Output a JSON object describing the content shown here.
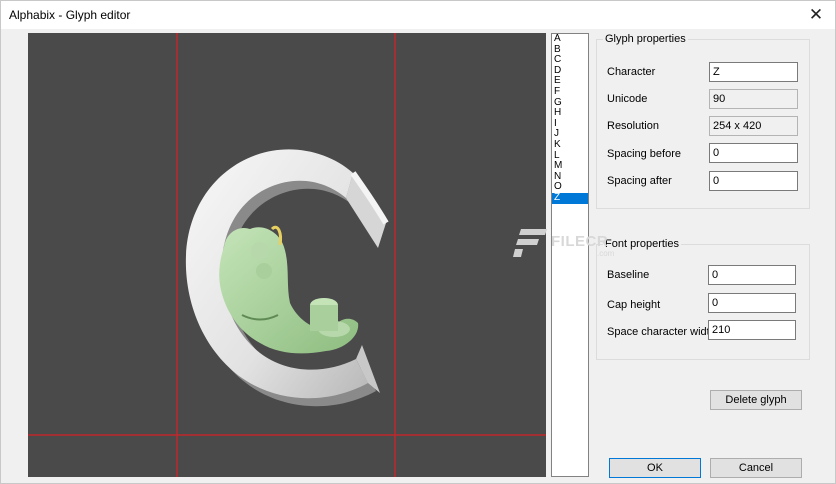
{
  "window": {
    "title": "Alphabix - Glyph editor",
    "close_glyph": "✕"
  },
  "glyph_list": {
    "items": [
      "A",
      "B",
      "C",
      "D",
      "E",
      "F",
      "G",
      "H",
      "I",
      "J",
      "K",
      "L",
      "M",
      "N",
      "O",
      "Z"
    ],
    "selected": "Z"
  },
  "glyph_properties": {
    "title": "Glyph properties",
    "character_label": "Character",
    "character_value": "Z",
    "unicode_label": "Unicode",
    "unicode_value": "90",
    "resolution_label": "Resolution",
    "resolution_value": "254 x 420",
    "spacing_before_label": "Spacing before",
    "spacing_before_value": "0",
    "spacing_after_label": "Spacing after",
    "spacing_after_value": "0"
  },
  "font_properties": {
    "title": "Font properties",
    "baseline_label": "Baseline",
    "baseline_value": "0",
    "cap_height_label": "Cap height",
    "cap_height_value": "0",
    "space_width_label": "Space character width",
    "space_width_value": "210"
  },
  "buttons": {
    "delete_glyph": "Delete glyph",
    "ok": "OK",
    "cancel": "Cancel"
  },
  "watermark": {
    "text": "FILECR",
    "sub": ".com"
  },
  "colors": {
    "canvas_bg": "#4a4a4a",
    "guide_line": "#c0282a",
    "selection": "#0078d7",
    "glyph_white": "#e6e6e6",
    "character_green": "#a8cf9c"
  }
}
